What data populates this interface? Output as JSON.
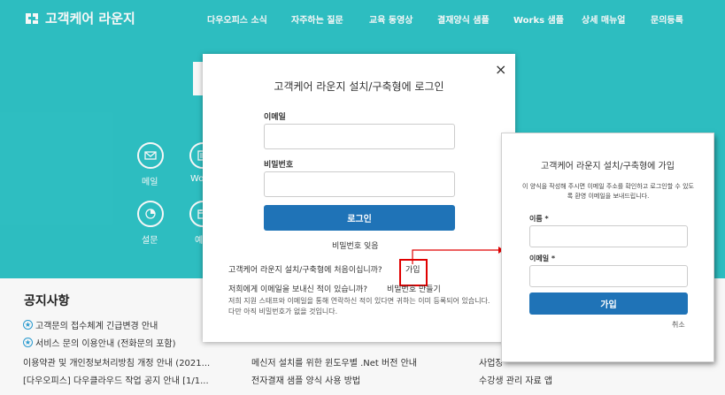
{
  "header": {
    "brand": "고객케어 라운지",
    "nav": [
      "다우오피스 소식",
      "자주하는 질문",
      "교육 동영상",
      "결재양식 샘플",
      "Works 샘플",
      "상세 매뉴얼",
      "문의등록"
    ]
  },
  "hero": {
    "icons": [
      {
        "label": "메일",
        "icon": "mail-icon"
      },
      {
        "label": "Wo",
        "icon": "works-icon"
      },
      {
        "label": "설문",
        "icon": "survey-icon"
      },
      {
        "label": "예",
        "icon": "reservation-icon"
      }
    ]
  },
  "notice": {
    "title": "공지사항",
    "items": [
      {
        "text": "고객문의 접수체계 긴급변경 안내",
        "starred": true
      },
      {
        "text": "서비스 문의 이용안내 (전화문의 포함)",
        "starred": true
      },
      {
        "text": "이용약관 및 개인정보처리방침 개정 안내 (2021...",
        "starred": false
      },
      {
        "text": "[다우오피스] 다우클라우드 작업 공지 안내 [1/1...",
        "starred": false
      }
    ],
    "col2": [
      "메신저 설치를 위한 윈도우별 .Net 버전 안내",
      "전자결재 샘플 양식 사용 방법"
    ],
    "col3": [
      "사업장",
      "수강생 관리 자료 앱"
    ]
  },
  "login_modal": {
    "title": "고객케어 라운지 설치/구축형에 로그인",
    "close": "×",
    "email_label": "이메일",
    "email_value": "",
    "password_label": "비밀번호",
    "password_value": "",
    "login_button": "로그인",
    "forgot_link": "비밀번호 잊음",
    "first_time_text": "고객케어 라운지 설치/구축형에 처음이십니까?",
    "join_link": "가입",
    "emailed_text": "저희에게 이메일을 보내신 적이 있습니까?",
    "make_password_link": "비밀번호 만들기",
    "info_text": "저희 지원 스태프와 이메일을 통해 연락하신 적이 있다면 귀하는 이미 등록되어 있습니다. 다만 아직 비밀번호가 없을 것입니다."
  },
  "signup_modal": {
    "title": "고객케어 라운지 설치/구축형에 가입",
    "description": "이 양식을 작성해 주시면 이메일 주소를 확인하고 로그인할 수 있도록 환영 이메일을 보내드립니다.",
    "name_label": "이름 *",
    "name_value": "",
    "email_label": "이메일 *",
    "email_value": "",
    "join_button": "가입",
    "cancel": "취소"
  },
  "colors": {
    "teal": "#2fc4c7",
    "primary": "#1f73b7",
    "highlight": "#e00000"
  }
}
